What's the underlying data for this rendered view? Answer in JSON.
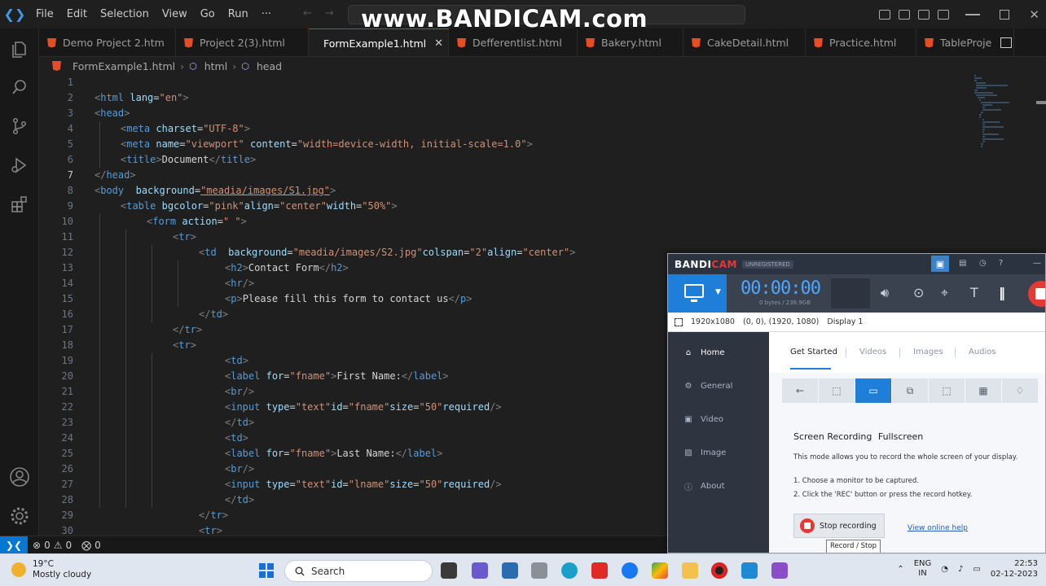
{
  "menu": [
    "File",
    "Edit",
    "Selection",
    "View",
    "Go",
    "Run",
    "···"
  ],
  "watermark": "www.BANDICAM.com",
  "tabs": [
    {
      "label": "Demo Project 2.htm",
      "active": false
    },
    {
      "label": "Project 2(3).html",
      "active": false
    },
    {
      "label": "FormExample1.html",
      "active": true
    },
    {
      "label": "Defferentlist.html",
      "active": false
    },
    {
      "label": "Bakery.html",
      "active": false
    },
    {
      "label": "CakeDetail.html",
      "active": false
    },
    {
      "label": "Practice.html",
      "active": false
    },
    {
      "label": "TableProje",
      "active": false
    }
  ],
  "breadcrumb": {
    "file": "FormExample1.html",
    "html": "html",
    "head": "head"
  },
  "editor": {
    "current_line": 7,
    "lines": [
      {
        "n": "1",
        "indent": 0,
        "tokens": []
      },
      {
        "n": "2",
        "indent": 0,
        "tokens": [
          [
            "b",
            "<"
          ],
          [
            "t",
            "html"
          ],
          [
            "x",
            " "
          ],
          [
            "a",
            "lang"
          ],
          [
            "x",
            "="
          ],
          [
            "s",
            "\"en\""
          ],
          [
            "b",
            ">"
          ]
        ]
      },
      {
        "n": "3",
        "indent": 0,
        "tokens": [
          [
            "b",
            "<"
          ],
          [
            "t",
            "head"
          ],
          [
            "b",
            ">"
          ]
        ]
      },
      {
        "n": "4",
        "indent": 1,
        "tokens": [
          [
            "b",
            "<"
          ],
          [
            "t",
            "meta"
          ],
          [
            "x",
            " "
          ],
          [
            "a",
            "charset"
          ],
          [
            "x",
            "="
          ],
          [
            "s",
            "\"UTF-8\""
          ],
          [
            "b",
            ">"
          ]
        ]
      },
      {
        "n": "5",
        "indent": 1,
        "tokens": [
          [
            "b",
            "<"
          ],
          [
            "t",
            "meta"
          ],
          [
            "x",
            " "
          ],
          [
            "a",
            "name"
          ],
          [
            "x",
            "="
          ],
          [
            "s",
            "\"viewport\""
          ],
          [
            "x",
            " "
          ],
          [
            "a",
            "content"
          ],
          [
            "x",
            "="
          ],
          [
            "s",
            "\"width=device-width, initial-scale=1.0\""
          ],
          [
            "b",
            ">"
          ]
        ]
      },
      {
        "n": "6",
        "indent": 1,
        "tokens": [
          [
            "b",
            "<"
          ],
          [
            "t",
            "title"
          ],
          [
            "b",
            ">"
          ],
          [
            "x",
            "Document"
          ],
          [
            "b",
            "</"
          ],
          [
            "t",
            "title"
          ],
          [
            "b",
            ">"
          ]
        ]
      },
      {
        "n": "7",
        "indent": 0,
        "tokens": [
          [
            "b",
            "</"
          ],
          [
            "t",
            "head"
          ],
          [
            "b",
            ">"
          ]
        ]
      },
      {
        "n": "8",
        "indent": 0,
        "tokens": [
          [
            "b",
            "<"
          ],
          [
            "t",
            "body"
          ],
          [
            "x",
            "  "
          ],
          [
            "a",
            "background"
          ],
          [
            "x",
            "="
          ],
          [
            "su",
            "\"meadia/images/S1.jpg\""
          ],
          [
            "b",
            ">"
          ]
        ]
      },
      {
        "n": "9",
        "indent": 1,
        "tokens": [
          [
            "b",
            "<"
          ],
          [
            "t",
            "table"
          ],
          [
            "x",
            " "
          ],
          [
            "a",
            "bgcolor"
          ],
          [
            "x",
            "="
          ],
          [
            "s",
            "\"pink\""
          ],
          [
            "a",
            "align"
          ],
          [
            "x",
            "="
          ],
          [
            "s",
            "\"center\""
          ],
          [
            "a",
            "width"
          ],
          [
            "x",
            "="
          ],
          [
            "s",
            "\"50%\""
          ],
          [
            "b",
            ">"
          ]
        ]
      },
      {
        "n": "10",
        "indent": 2,
        "tokens": [
          [
            "b",
            "<"
          ],
          [
            "t",
            "form"
          ],
          [
            "x",
            " "
          ],
          [
            "a",
            "action"
          ],
          [
            "x",
            "="
          ],
          [
            "s",
            "\" \""
          ],
          [
            "b",
            ">"
          ]
        ]
      },
      {
        "n": "11",
        "indent": 3,
        "tokens": [
          [
            "b",
            "<"
          ],
          [
            "t",
            "tr"
          ],
          [
            "b",
            ">"
          ]
        ]
      },
      {
        "n": "12",
        "indent": 4,
        "tokens": [
          [
            "b",
            "<"
          ],
          [
            "t",
            "td"
          ],
          [
            "x",
            "  "
          ],
          [
            "a",
            "background"
          ],
          [
            "x",
            "="
          ],
          [
            "s",
            "\"meadia/images/S2.jpg\""
          ],
          [
            "a",
            "colspan"
          ],
          [
            "x",
            "="
          ],
          [
            "s",
            "\"2\""
          ],
          [
            "a",
            "align"
          ],
          [
            "x",
            "="
          ],
          [
            "s",
            "\"center\""
          ],
          [
            "b",
            ">"
          ]
        ]
      },
      {
        "n": "13",
        "indent": 5,
        "tokens": [
          [
            "b",
            "<"
          ],
          [
            "t",
            "h2"
          ],
          [
            "b",
            ">"
          ],
          [
            "x",
            "Contact Form"
          ],
          [
            "b",
            "</"
          ],
          [
            "t",
            "h2"
          ],
          [
            "b",
            ">"
          ]
        ]
      },
      {
        "n": "14",
        "indent": 5,
        "tokens": [
          [
            "b",
            "<"
          ],
          [
            "t",
            "hr"
          ],
          [
            "b",
            "/>"
          ]
        ]
      },
      {
        "n": "15",
        "indent": 5,
        "tokens": [
          [
            "b",
            "<"
          ],
          [
            "t",
            "p"
          ],
          [
            "b",
            ">"
          ],
          [
            "x",
            "Please fill this form to contact us"
          ],
          [
            "b",
            "</"
          ],
          [
            "t",
            "p"
          ],
          [
            "b",
            ">"
          ]
        ]
      },
      {
        "n": "16",
        "indent": 4,
        "tokens": [
          [
            "b",
            "</"
          ],
          [
            "t",
            "td"
          ],
          [
            "b",
            ">"
          ]
        ]
      },
      {
        "n": "17",
        "indent": 3,
        "tokens": [
          [
            "b",
            "</"
          ],
          [
            "t",
            "tr"
          ],
          [
            "b",
            ">"
          ]
        ]
      },
      {
        "n": "18",
        "indent": 3,
        "tokens": [
          [
            "b",
            "<"
          ],
          [
            "t",
            "tr"
          ],
          [
            "b",
            ">"
          ]
        ]
      },
      {
        "n": "19",
        "indent": 5,
        "tokens": [
          [
            "b",
            "<"
          ],
          [
            "t",
            "td"
          ],
          [
            "b",
            ">"
          ]
        ]
      },
      {
        "n": "20",
        "indent": 5,
        "tokens": [
          [
            "b",
            "<"
          ],
          [
            "t",
            "label"
          ],
          [
            "x",
            " "
          ],
          [
            "a",
            "for"
          ],
          [
            "x",
            "="
          ],
          [
            "s",
            "\"fname\""
          ],
          [
            "b",
            ">"
          ],
          [
            "x",
            "First Name:"
          ],
          [
            "b",
            "</"
          ],
          [
            "t",
            "label"
          ],
          [
            "b",
            ">"
          ]
        ]
      },
      {
        "n": "21",
        "indent": 5,
        "tokens": [
          [
            "b",
            "<"
          ],
          [
            "t",
            "br"
          ],
          [
            "b",
            "/>"
          ]
        ]
      },
      {
        "n": "22",
        "indent": 5,
        "tokens": [
          [
            "b",
            "<"
          ],
          [
            "t",
            "input"
          ],
          [
            "x",
            " "
          ],
          [
            "a",
            "type"
          ],
          [
            "x",
            "="
          ],
          [
            "s",
            "\"text\""
          ],
          [
            "a",
            "id"
          ],
          [
            "x",
            "="
          ],
          [
            "s",
            "\"fname\""
          ],
          [
            "a",
            "size"
          ],
          [
            "x",
            "="
          ],
          [
            "s",
            "\"50\""
          ],
          [
            "a",
            "required"
          ],
          [
            "b",
            "/>"
          ]
        ]
      },
      {
        "n": "23",
        "indent": 5,
        "tokens": [
          [
            "b",
            "</"
          ],
          [
            "t",
            "td"
          ],
          [
            "b",
            ">"
          ]
        ]
      },
      {
        "n": "24",
        "indent": 5,
        "tokens": [
          [
            "b",
            "<"
          ],
          [
            "t",
            "td"
          ],
          [
            "b",
            ">"
          ]
        ]
      },
      {
        "n": "25",
        "indent": 5,
        "tokens": [
          [
            "b",
            "<"
          ],
          [
            "t",
            "label"
          ],
          [
            "x",
            " "
          ],
          [
            "a",
            "for"
          ],
          [
            "x",
            "="
          ],
          [
            "s",
            "\"fname\""
          ],
          [
            "b",
            ">"
          ],
          [
            "x",
            "Last Name:"
          ],
          [
            "b",
            "</"
          ],
          [
            "t",
            "label"
          ],
          [
            "b",
            ">"
          ]
        ]
      },
      {
        "n": "26",
        "indent": 5,
        "tokens": [
          [
            "b",
            "<"
          ],
          [
            "t",
            "br"
          ],
          [
            "b",
            "/>"
          ]
        ]
      },
      {
        "n": "27",
        "indent": 5,
        "tokens": [
          [
            "b",
            "<"
          ],
          [
            "t",
            "input"
          ],
          [
            "x",
            " "
          ],
          [
            "a",
            "type"
          ],
          [
            "x",
            "="
          ],
          [
            "s",
            "\"text\""
          ],
          [
            "a",
            "id"
          ],
          [
            "x",
            "="
          ],
          [
            "s",
            "\"lname\""
          ],
          [
            "a",
            "size"
          ],
          [
            "x",
            "="
          ],
          [
            "s",
            "\"50\""
          ],
          [
            "a",
            "required"
          ],
          [
            "b",
            "/>"
          ]
        ]
      },
      {
        "n": "28",
        "indent": 5,
        "tokens": [
          [
            "b",
            "</"
          ],
          [
            "t",
            "td"
          ],
          [
            "b",
            ">"
          ]
        ]
      },
      {
        "n": "29",
        "indent": 4,
        "tokens": [
          [
            "b",
            "</"
          ],
          [
            "t",
            "tr"
          ],
          [
            "b",
            ">"
          ]
        ]
      },
      {
        "n": "30",
        "indent": 4,
        "tokens": [
          [
            "b",
            "<"
          ],
          [
            "t",
            "tr"
          ],
          [
            "b",
            ">"
          ]
        ]
      }
    ]
  },
  "statusbar": {
    "errors": "0",
    "warnings": "0",
    "ports": "0"
  },
  "taskbar": {
    "weather_temp": "19°C",
    "weather_desc": "Mostly cloudy",
    "search_placeholder": "Search",
    "lang1": "ENG",
    "lang2": "IN",
    "time": "22:53",
    "date": "02-12-2023"
  },
  "bandicam": {
    "logo_a": "BANDI",
    "logo_b": "CAM",
    "unregistered": "UNREGISTERED",
    "timer": "00:00:00",
    "size": "0 bytes / 236.9GB",
    "resolution": "1920x1080",
    "coords": "(0, 0), (1920, 1080)",
    "display": "Display 1",
    "nav": [
      "Home",
      "General",
      "Video",
      "Image",
      "About"
    ],
    "tabs": [
      "Get Started",
      "Videos",
      "Images",
      "Audios"
    ],
    "heading_a": "Screen Recording",
    "heading_b": "Fullscreen",
    "desc": "This mode allows you to record the whole screen of your display.",
    "step1": "1. Choose a monitor to be captured.",
    "step2": "2. Click the 'REC' button or press the record hotkey.",
    "stop_label": "Stop recording",
    "help_link": "View online help",
    "tooltip": "Record / Stop"
  }
}
